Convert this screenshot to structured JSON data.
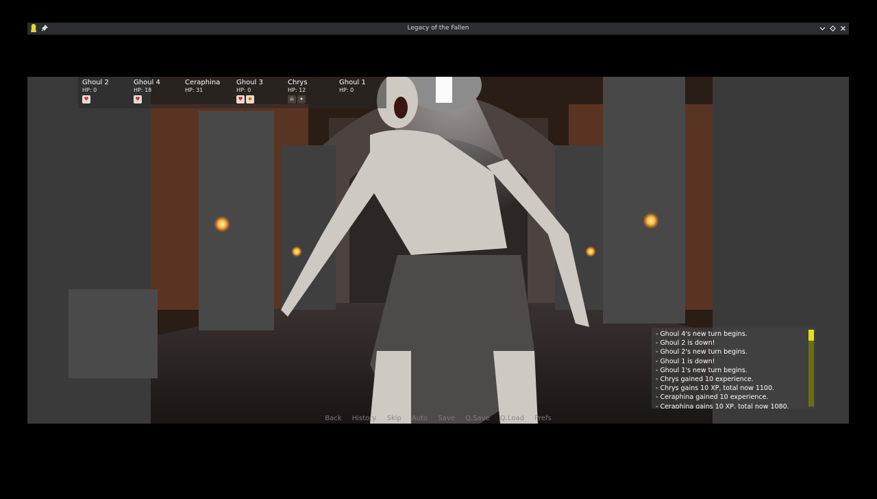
{
  "window": {
    "title": "Legacy of the Fallen",
    "icons": [
      "app-icon",
      "pin-icon",
      "chevron-down-icon",
      "diamond-icon",
      "close-icon"
    ]
  },
  "party": [
    {
      "name": "Ghoul 2",
      "hp": "HP: 0",
      "effects": [
        "heart"
      ]
    },
    {
      "name": "Ghoul 4",
      "hp": "HP: 18",
      "effects": [
        "heart"
      ]
    },
    {
      "name": "Ceraphina",
      "hp": "HP: 31",
      "effects": []
    },
    {
      "name": "Ghoul 3",
      "hp": "HP: 0",
      "effects": [
        "heart",
        "flame"
      ]
    },
    {
      "name": "Chrys",
      "hp": "HP: 12",
      "effects": [
        "skull",
        "figure"
      ]
    },
    {
      "name": "Ghoul 1",
      "hp": "HP: 0",
      "effects": []
    }
  ],
  "log": [
    "- Ghoul 4's new turn begins.",
    "- Ghoul 2 is down!",
    "- Ghoul 2's new turn begins.",
    "- Ghoul 1 is down!",
    "- Ghoul 1's new turn begins.",
    "- Chrys gained 10 experience.",
    "- Chrys gains 10 XP, total now 1100.",
    "- Ceraphina gained 10 experience.",
    "- Ceraphina gains 10 XP, total now 1080."
  ],
  "quick_menu": [
    "Back",
    "History",
    "Skip",
    "Auto",
    "Save",
    "Q.Save",
    "Q.Load",
    "Prefs"
  ],
  "colors": {
    "scroll_thumb": "#e2e20c",
    "scroll_track": "#6b6e10",
    "titlebar": "#2b2d30"
  }
}
